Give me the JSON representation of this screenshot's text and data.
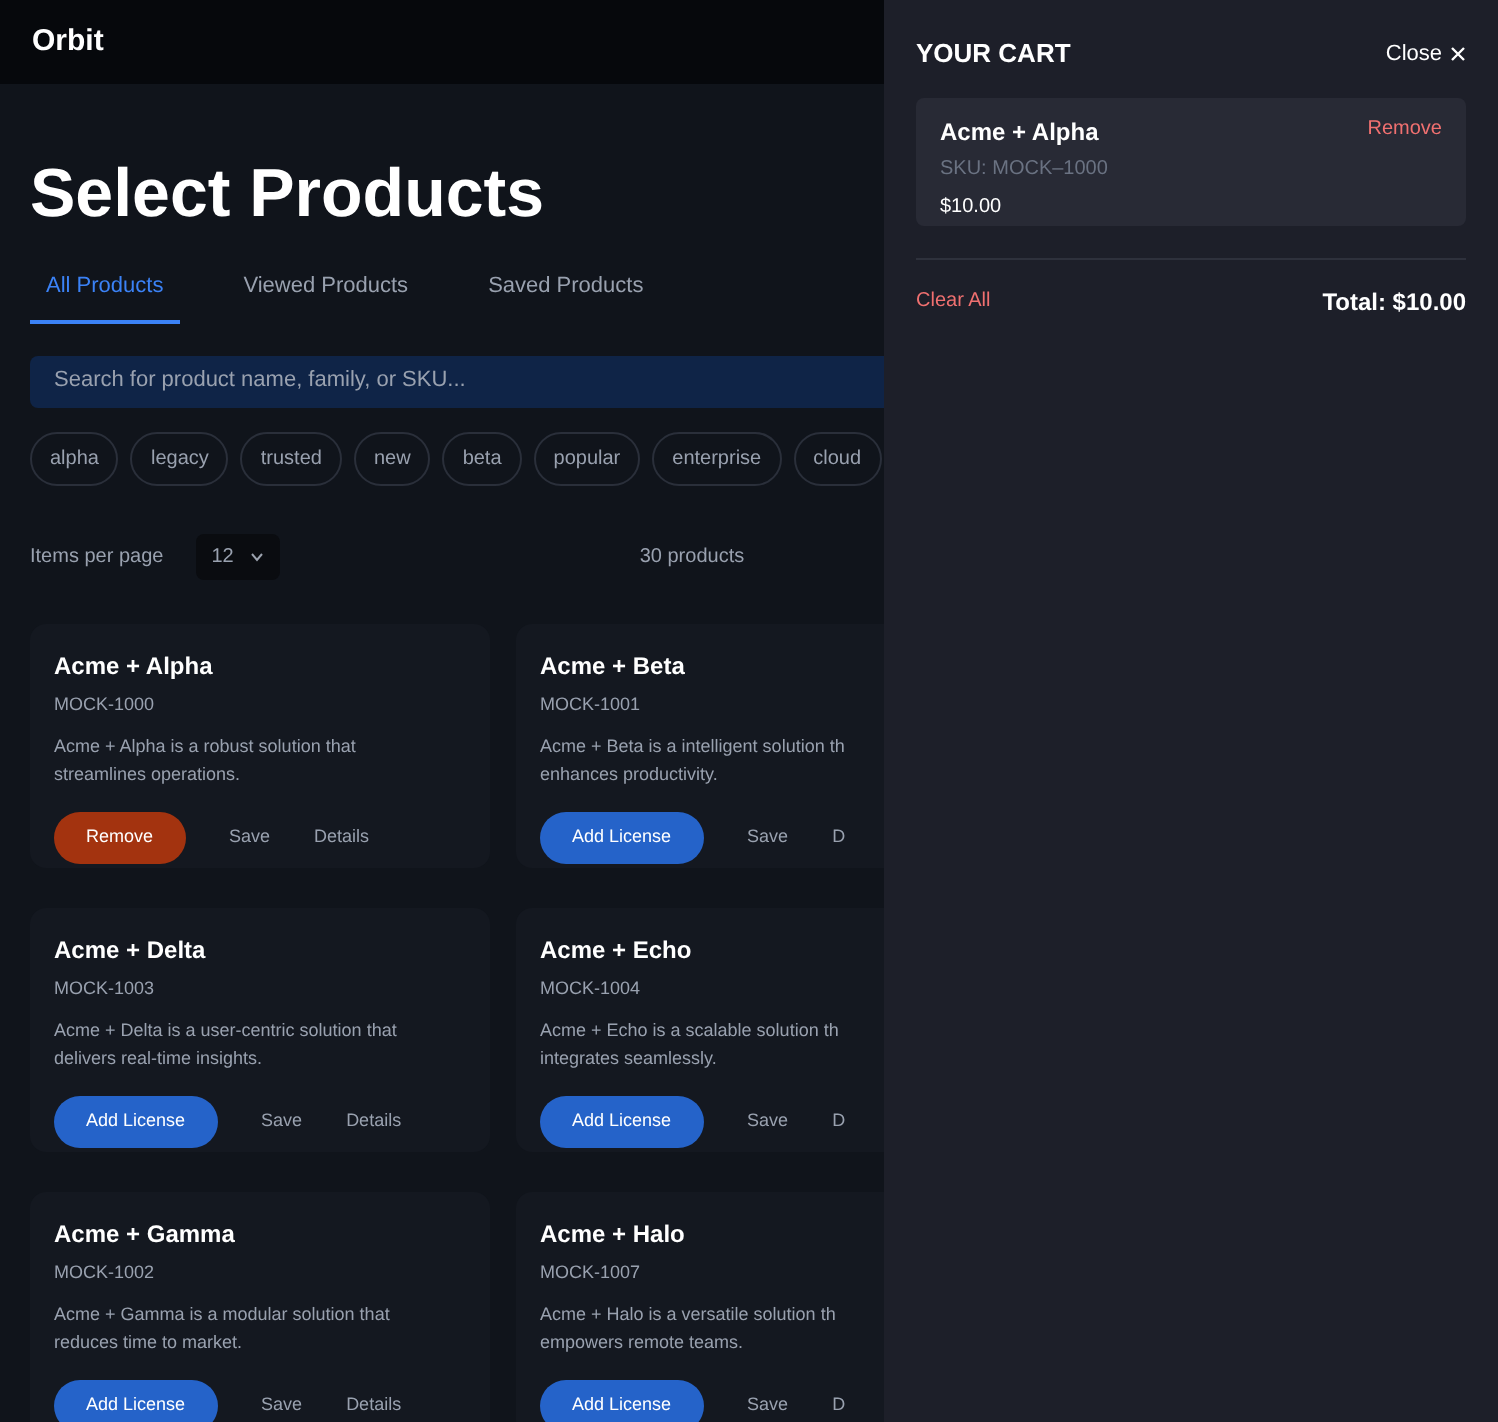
{
  "header": {
    "brand": "Orbit"
  },
  "page": {
    "title": "Select Products",
    "tabs": [
      {
        "label": "All Products",
        "selected": true
      },
      {
        "label": "Viewed Products",
        "selected": false
      },
      {
        "label": "Saved Products",
        "selected": false
      }
    ],
    "search": {
      "placeholder": "Search for product name, family, or SKU..."
    },
    "tags": [
      "alpha",
      "legacy",
      "trusted",
      "new",
      "beta",
      "popular",
      "enterprise",
      "cloud"
    ],
    "items_per_page": {
      "label": "Items per page",
      "value": "12"
    },
    "count": "30 products",
    "products": [
      {
        "name": "Acme + Alpha",
        "sku": "MOCK-1000",
        "description": [
          "Acme + Alpha is a robust solution that",
          "streamlines operations."
        ],
        "in_cart": true,
        "action": "Remove",
        "save": "Save",
        "details": "Details"
      },
      {
        "name": "Acme + Beta",
        "sku": "MOCK-1001",
        "description": [
          "Acme + Beta is a intelligent solution th",
          "enhances productivity."
        ],
        "in_cart": false,
        "action": "Add License",
        "save": "Save",
        "details": "D"
      },
      {
        "name": "Acme + Delta",
        "sku": "MOCK-1003",
        "description": [
          "Acme + Delta is a user-centric solution that",
          "delivers real-time insights."
        ],
        "in_cart": false,
        "action": "Add License",
        "save": "Save",
        "details": "Details"
      },
      {
        "name": "Acme + Echo",
        "sku": "MOCK-1004",
        "description": [
          "Acme + Echo is a scalable solution th",
          "integrates seamlessly."
        ],
        "in_cart": false,
        "action": "Add License",
        "save": "Save",
        "details": "D"
      },
      {
        "name": "Acme + Gamma",
        "sku": "MOCK-1002",
        "description": [
          "Acme + Gamma is a modular solution that",
          "reduces time to market."
        ],
        "in_cart": false,
        "action": "Add License",
        "save": "Save",
        "details": "Details"
      },
      {
        "name": "Acme + Halo",
        "sku": "MOCK-1007",
        "description": [
          "Acme + Halo is a versatile solution th",
          "empowers remote teams."
        ],
        "in_cart": false,
        "action": "Add License",
        "save": "Save",
        "details": "D"
      }
    ]
  },
  "cart": {
    "title": "YOUR CART",
    "close": "Close",
    "items": [
      {
        "name": "Acme + Alpha",
        "sku": "SKU: MOCK–1000",
        "price": "$10.00",
        "remove": "Remove"
      }
    ],
    "clear": "Clear All",
    "total": "Total: $10.00"
  }
}
